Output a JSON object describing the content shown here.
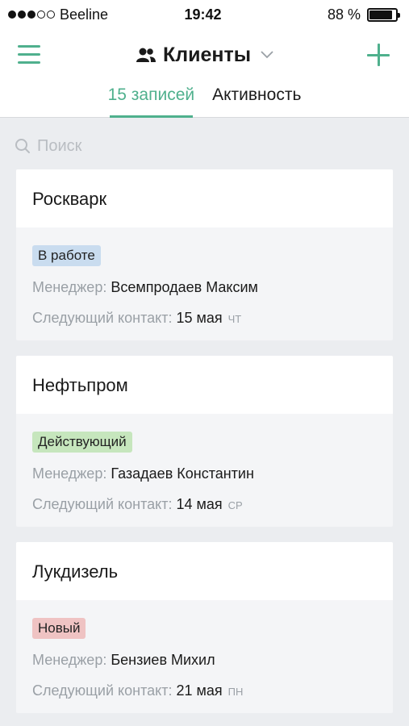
{
  "status_bar": {
    "carrier": "Beeline",
    "time": "19:42",
    "battery_percent": "88 %",
    "battery_level": 0.88,
    "signal_filled": 3,
    "signal_total": 5
  },
  "header": {
    "title": "Клиенты",
    "tabs": [
      {
        "label": "15 записей",
        "active": true
      },
      {
        "label": "Активность",
        "active": false
      }
    ]
  },
  "search": {
    "placeholder": "Поиск"
  },
  "colors": {
    "accent": "#4fb08d",
    "badge_work": "#c9dcef",
    "badge_active": "#c6e6bd",
    "badge_new": "#efc3c3"
  },
  "labels": {
    "manager": "Менеджер:",
    "next_contact": "Следующий контакт:"
  },
  "clients": [
    {
      "name": "Роскварк",
      "status": "В работе",
      "status_color": "#c9dcef",
      "manager": "Всемпродаев Максим",
      "next_date": "15 мая",
      "next_dow": "ЧТ"
    },
    {
      "name": "Нефтьпром",
      "status": "Действующий",
      "status_color": "#c6e6bd",
      "manager": "Газадаев Константин",
      "next_date": "14 мая",
      "next_dow": "СР"
    },
    {
      "name": "Лукдизель",
      "status": "Новый",
      "status_color": "#efc3c3",
      "manager": "Бензиев Михил",
      "next_date": "21 мая",
      "next_dow": "ПН"
    }
  ]
}
